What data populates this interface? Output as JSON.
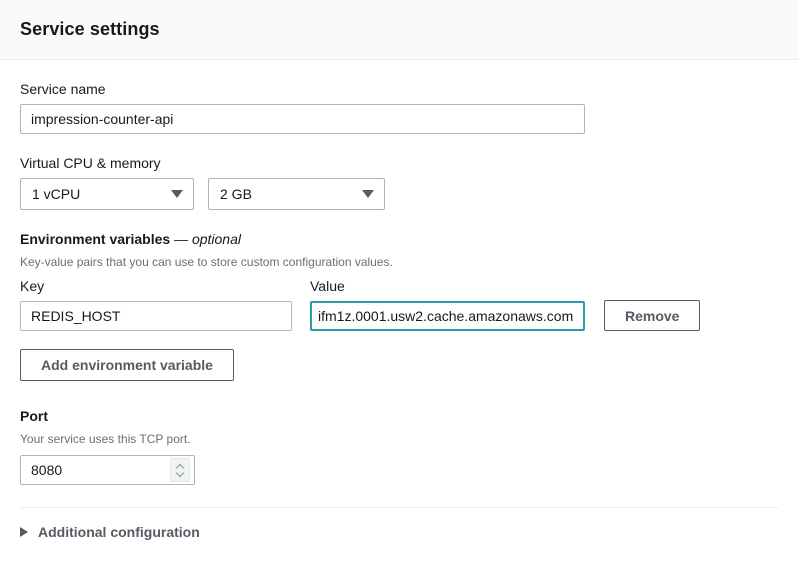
{
  "header": {
    "title": "Service settings"
  },
  "service_name": {
    "label": "Service name",
    "value": "impression-counter-api"
  },
  "cpu_memory": {
    "label": "Virtual CPU & memory",
    "cpu_value": "1 vCPU",
    "memory_value": "2 GB"
  },
  "environment_variables": {
    "label": "Environment variables",
    "optional_suffix": "— optional",
    "description": "Key-value pairs that you can use to store custom configuration values.",
    "column_key": "Key",
    "column_value": "Value",
    "rows": [
      {
        "key": "REDIS_HOST",
        "value": "ifm1z.0001.usw2.cache.amazonaws.com",
        "remove_label": "Remove"
      }
    ],
    "add_label": "Add environment variable"
  },
  "port": {
    "label": "Port",
    "description": "Your service uses this TCP port.",
    "value": "8080"
  },
  "additional_configuration": {
    "label": "Additional configuration"
  },
  "colors": {
    "focus_border": "#2a9ba8",
    "input_border": "#aab7b8",
    "text": "#16191f",
    "muted_text": "#687078",
    "header_bg": "#fafafa",
    "divider": "#eaeded"
  }
}
